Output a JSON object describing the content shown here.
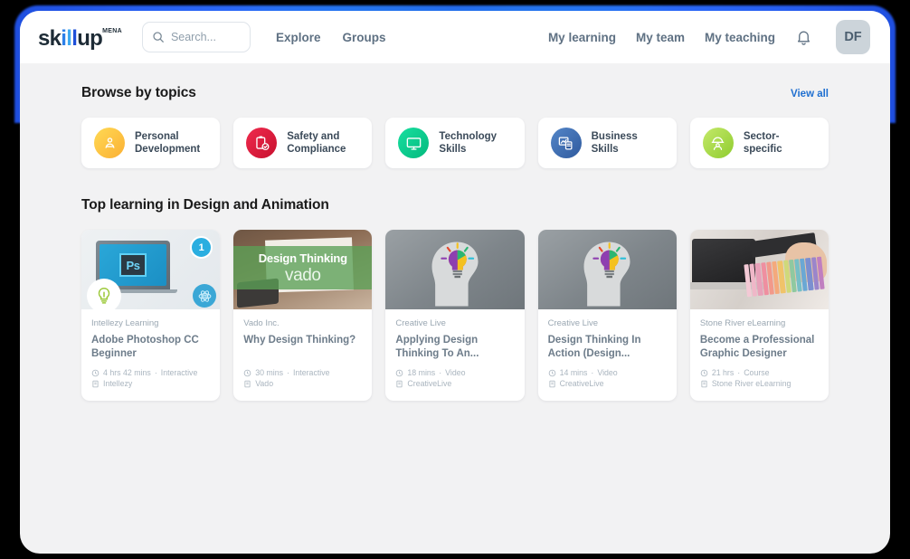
{
  "header": {
    "logo": {
      "part1": "sk",
      "part2": "i",
      "part3": "l",
      "part4": "l",
      "part5": "up",
      "superscript": "MENA"
    },
    "search": {
      "placeholder": "Search...",
      "value": "",
      "icon": "search-icon"
    },
    "nav_left": [
      {
        "label": "Explore"
      },
      {
        "label": "Groups"
      }
    ],
    "nav_right": [
      {
        "label": "My learning"
      },
      {
        "label": "My team"
      },
      {
        "label": "My teaching"
      }
    ],
    "notifications_icon": "bell-icon",
    "avatar": {
      "initials": "DF"
    }
  },
  "topics_section": {
    "title": "Browse by topics",
    "view_all": "View all",
    "items": [
      {
        "label": "Personal Development",
        "icon": "person-icon",
        "color": "#fdc830"
      },
      {
        "label": "Safety and Compliance",
        "icon": "clipboard-check-icon",
        "color": "#e01e37"
      },
      {
        "label": "Technology Skills",
        "icon": "monitor-icon",
        "color": "#0ec98a"
      },
      {
        "label": "Business Skills",
        "icon": "chart-document-icon",
        "color": "#3d6fb4"
      },
      {
        "label": "Sector-specific",
        "icon": "worker-icon",
        "color": "#a8d94a"
      }
    ]
  },
  "courses_section": {
    "title": "Top learning in Design and Animation",
    "cards": [
      {
        "provider": "Intellezy Learning",
        "title": "Adobe Photoshop CC Beginner",
        "duration": "4 hrs 42 mins",
        "separator": "·",
        "format": "Interactive",
        "source": "Intellezy",
        "thumb_badge": "1",
        "thumb_text": "Ps"
      },
      {
        "provider": "Vado Inc.",
        "title": "Why Design Thinking?",
        "duration": "30 mins",
        "separator": "·",
        "format": "Interactive",
        "source": "Vado",
        "thumb_title": "Design Thinking",
        "thumb_subtitle": "vado"
      },
      {
        "provider": "Creative Live",
        "title": "Applying Design Thinking To An...",
        "duration": "18 mins",
        "separator": "·",
        "format": "Video",
        "source": "CreativeLive"
      },
      {
        "provider": "Creative Live",
        "title": "Design Thinking In Action (Design...",
        "duration": "14 mins",
        "separator": "·",
        "format": "Video",
        "source": "CreativeLive"
      },
      {
        "provider": "Stone River eLearning",
        "title": "Become a Professional Graphic Designer",
        "duration": "21 hrs",
        "separator": "·",
        "format": "Course",
        "source": "Stone River eLearning"
      }
    ]
  },
  "colors": {
    "accent_blue": "#1f6fd0",
    "page_bg": "#f2f2f3",
    "header_bg": "#ffffff",
    "text_dark": "#1a1a1a",
    "text_muted": "#9aa7b2",
    "glow": "#2f6bff"
  }
}
